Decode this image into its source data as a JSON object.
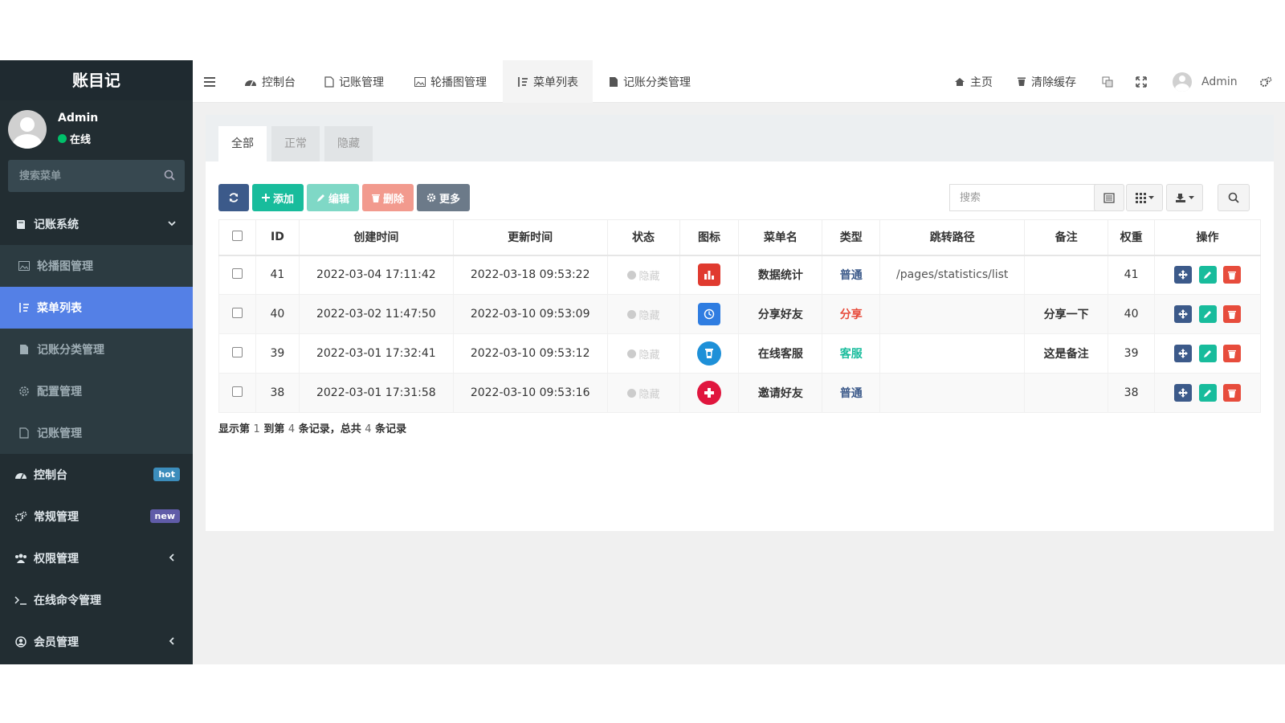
{
  "app": {
    "logo": "账目记"
  },
  "user": {
    "name": "Admin",
    "status": "在线"
  },
  "sidebar": {
    "search_placeholder": "搜索菜单",
    "items": [
      {
        "label": "记账系统",
        "type": "parent",
        "icon": "book-icon",
        "arrow": "chevron-down-icon"
      },
      {
        "label": "轮播图管理",
        "type": "child",
        "icon": "image-icon"
      },
      {
        "label": "菜单列表",
        "type": "child-active",
        "icon": "list-sort-icon"
      },
      {
        "label": "记账分类管理",
        "type": "child",
        "icon": "file-icon"
      },
      {
        "label": "配置管理",
        "type": "child",
        "icon": "gear-icon"
      },
      {
        "label": "记账管理",
        "type": "child",
        "icon": "document-icon"
      },
      {
        "label": "控制台",
        "type": "parent",
        "icon": "dashboard-icon",
        "badge": "hot"
      },
      {
        "label": "常规管理",
        "type": "parent",
        "icon": "cogs-icon",
        "badge": "new"
      },
      {
        "label": "权限管理",
        "type": "parent",
        "icon": "group-icon",
        "arrow": "chevron-left-icon"
      },
      {
        "label": "在线命令管理",
        "type": "parent",
        "icon": "terminal-icon"
      },
      {
        "label": "会员管理",
        "type": "parent",
        "icon": "user-circle-icon",
        "arrow": "chevron-left-icon"
      }
    ]
  },
  "topbar": {
    "tabs": [
      {
        "label": "控制台",
        "icon": "dashboard-icon"
      },
      {
        "label": "记账管理",
        "icon": "document-icon"
      },
      {
        "label": "轮播图管理",
        "icon": "image-icon"
      },
      {
        "label": "菜单列表",
        "icon": "list-sort-icon",
        "active": true
      },
      {
        "label": "记账分类管理",
        "icon": "file-icon"
      }
    ],
    "home": "主页",
    "clear_cache": "清除缓存",
    "user_name": "Admin"
  },
  "filter_tabs": [
    "全部",
    "正常",
    "隐藏"
  ],
  "toolbar": {
    "add": "添加",
    "edit": "编辑",
    "delete": "删除",
    "more": "更多",
    "search_placeholder": "搜索"
  },
  "table": {
    "headers": [
      "ID",
      "创建时间",
      "更新时间",
      "状态",
      "图标",
      "菜单名",
      "类型",
      "跳转路径",
      "备注",
      "权重",
      "操作"
    ],
    "rows": [
      {
        "id": "41",
        "created": "2022-03-04 17:11:42",
        "updated": "2022-03-18 09:53:22",
        "status": "隐藏",
        "icon": "bar-chart-icon",
        "icon_color": "#e03a2f",
        "name": "数据统计",
        "type": "普通",
        "type_class": "normal",
        "path": "/pages/statistics/list",
        "remark": "",
        "weight": "41"
      },
      {
        "id": "40",
        "created": "2022-03-02 11:47:50",
        "updated": "2022-03-10 09:53:09",
        "status": "隐藏",
        "icon": "share-clock-icon",
        "icon_color": "#2f7de1",
        "name": "分享好友",
        "type": "分享",
        "type_class": "share",
        "path": "",
        "remark": "分享一下",
        "weight": "40"
      },
      {
        "id": "39",
        "created": "2022-03-01 17:32:41",
        "updated": "2022-03-10 09:53:12",
        "status": "隐藏",
        "icon": "service-cup-icon",
        "icon_color": "#1e90d8",
        "name": "在线客服",
        "type": "客服",
        "type_class": "service",
        "path": "",
        "remark": "这是备注",
        "weight": "39"
      },
      {
        "id": "38",
        "created": "2022-03-01 17:31:58",
        "updated": "2022-03-10 09:53:16",
        "status": "隐藏",
        "icon": "plus-circle-icon",
        "icon_color": "#e0163e",
        "name": "邀请好友",
        "type": "普通",
        "type_class": "normal",
        "path": "",
        "remark": "",
        "weight": "38"
      }
    ]
  },
  "pager": {
    "p1": "显示第",
    "from": "1",
    "p2": "到第",
    "to": "4",
    "p3": "条记录，总共",
    "total": "4",
    "p4": "条记录"
  }
}
